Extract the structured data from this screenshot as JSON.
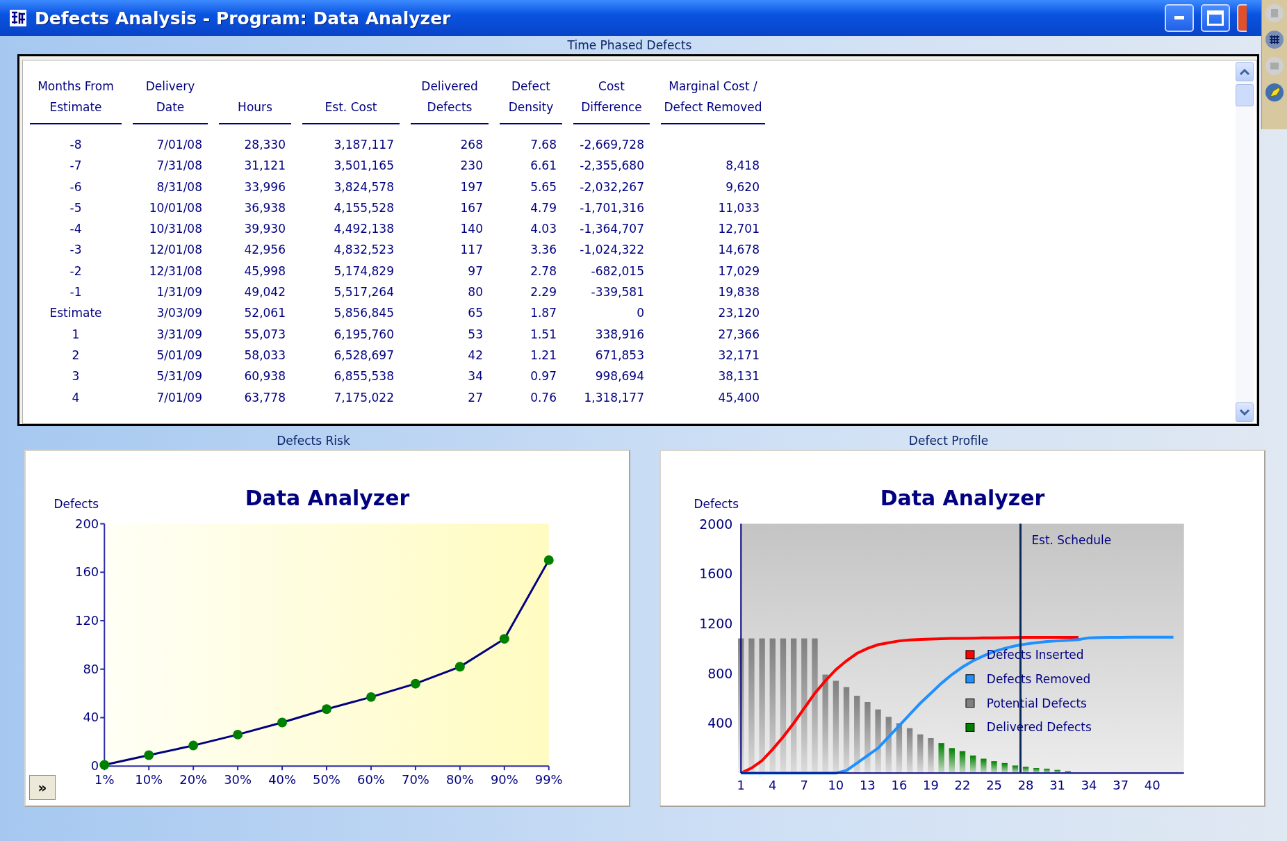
{
  "window": {
    "title": "Defects Analysis - Program: Data Analyzer"
  },
  "table": {
    "title": "Time Phased Defects",
    "columns": [
      "Months From\nEstimate",
      "Delivery\nDate",
      "Hours",
      "Est. Cost",
      "Delivered\nDefects",
      "Defect\nDensity",
      "Cost\nDifference",
      "Marginal Cost /\nDefect Removed"
    ],
    "rows": [
      [
        "-8",
        "7/01/08",
        "28,330",
        "3,187,117",
        "268",
        "7.68",
        "-2,669,728",
        ""
      ],
      [
        "-7",
        "7/31/08",
        "31,121",
        "3,501,165",
        "230",
        "6.61",
        "-2,355,680",
        "8,418"
      ],
      [
        "-6",
        "8/31/08",
        "33,996",
        "3,824,578",
        "197",
        "5.65",
        "-2,032,267",
        "9,620"
      ],
      [
        "-5",
        "10/01/08",
        "36,938",
        "4,155,528",
        "167",
        "4.79",
        "-1,701,316",
        "11,033"
      ],
      [
        "-4",
        "10/31/08",
        "39,930",
        "4,492,138",
        "140",
        "4.03",
        "-1,364,707",
        "12,701"
      ],
      [
        "-3",
        "12/01/08",
        "42,956",
        "4,832,523",
        "117",
        "3.36",
        "-1,024,322",
        "14,678"
      ],
      [
        "-2",
        "12/31/08",
        "45,998",
        "5,174,829",
        "97",
        "2.78",
        "-682,015",
        "17,029"
      ],
      [
        "-1",
        "1/31/09",
        "49,042",
        "5,517,264",
        "80",
        "2.29",
        "-339,581",
        "19,838"
      ],
      [
        "Estimate",
        "3/03/09",
        "52,061",
        "5,856,845",
        "65",
        "1.87",
        "0",
        "23,120"
      ],
      [
        "1",
        "3/31/09",
        "55,073",
        "6,195,760",
        "53",
        "1.51",
        "338,916",
        "27,366"
      ],
      [
        "2",
        "5/01/09",
        "58,033",
        "6,528,697",
        "42",
        "1.21",
        "671,853",
        "32,171"
      ],
      [
        "3",
        "5/31/09",
        "60,938",
        "6,855,538",
        "34",
        "0.97",
        "998,694",
        "38,131"
      ],
      [
        "4",
        "7/01/09",
        "63,778",
        "7,175,022",
        "27",
        "0.76",
        "1,318,177",
        "45,400"
      ]
    ]
  },
  "defects_risk": {
    "title": "Defects Risk",
    "expand_button": "»",
    "chart_data": {
      "type": "line",
      "title": "Data Analyzer",
      "ylabel": "Defects",
      "categories": [
        "1%",
        "10%",
        "20%",
        "30%",
        "40%",
        "50%",
        "60%",
        "70%",
        "80%",
        "90%",
        "99%"
      ],
      "series": [
        {
          "color": "#000080",
          "marker": true,
          "values": [
            1,
            9,
            17,
            26,
            36,
            47,
            57,
            68,
            82,
            105,
            170
          ]
        }
      ],
      "ylim": [
        0,
        200
      ],
      "yticks": [
        0,
        40,
        80,
        120,
        160,
        200
      ]
    }
  },
  "defect_profile": {
    "title": "Defect Profile",
    "chart_data": {
      "type": "bar",
      "title": "Data Analyzer",
      "ylabel": "Defects",
      "x": [
        1,
        2,
        3,
        4,
        5,
        6,
        7,
        8,
        9,
        10,
        11,
        12,
        13,
        14,
        15,
        16,
        17,
        18,
        19,
        20,
        21,
        22,
        23,
        24,
        25,
        26,
        27,
        28,
        29,
        30,
        31,
        32,
        33,
        34,
        35,
        36,
        37,
        38,
        39,
        40,
        41,
        42
      ],
      "series": [
        {
          "name": "Defects Inserted",
          "type": "line",
          "color": "#ff0000",
          "values": [
            0,
            40,
            100,
            190,
            290,
            400,
            520,
            640,
            740,
            830,
            900,
            960,
            1000,
            1030,
            1045,
            1060,
            1068,
            1072,
            1075,
            1078,
            1080,
            1080,
            1082,
            1084,
            1085,
            1086,
            1087,
            1088,
            1088,
            1088,
            1088,
            1089,
            1089,
            null,
            null,
            null,
            null,
            null,
            null,
            null,
            null,
            null
          ]
        },
        {
          "name": "Defects Removed",
          "type": "line",
          "color": "#1e90ff",
          "values": [
            0,
            0,
            0,
            0,
            0,
            0,
            0,
            0,
            0,
            0,
            20,
            80,
            140,
            200,
            290,
            380,
            470,
            560,
            640,
            720,
            790,
            850,
            900,
            940,
            975,
            1000,
            1020,
            1035,
            1045,
            1055,
            1060,
            1065,
            1070,
            1085,
            1087,
            1088,
            1089,
            1090,
            1090,
            1090,
            1090,
            1090
          ]
        },
        {
          "name": "Potential Defects",
          "type": "bar",
          "color": "#808080",
          "values": [
            1080,
            1080,
            1080,
            1080,
            1080,
            1080,
            1080,
            1080,
            790,
            740,
            690,
            620,
            570,
            510,
            450,
            400,
            360,
            310,
            280,
            null,
            null,
            null,
            null,
            null,
            null,
            null,
            null,
            null,
            null,
            null,
            null,
            null,
            null,
            null,
            null,
            null,
            null,
            null,
            null,
            null,
            null,
            null
          ]
        },
        {
          "name": "Delivered Defects",
          "type": "bar",
          "color": "#008000",
          "values": [
            null,
            null,
            null,
            null,
            null,
            null,
            null,
            null,
            null,
            null,
            null,
            null,
            null,
            null,
            null,
            null,
            null,
            null,
            null,
            240,
            200,
            175,
            140,
            115,
            95,
            80,
            60,
            50,
            40,
            35,
            25,
            15,
            null,
            null,
            null,
            null,
            null,
            null,
            null,
            null,
            null,
            null
          ]
        }
      ],
      "xlim": [
        1,
        43
      ],
      "ylim": [
        0,
        2000
      ],
      "xticks": [
        1,
        4,
        7,
        10,
        13,
        16,
        19,
        22,
        25,
        28,
        31,
        34,
        37,
        40
      ],
      "yticks": [
        400,
        800,
        1200,
        1600,
        2000
      ],
      "legend": true,
      "ref_lines": [
        {
          "axis": "x",
          "value": 27.5,
          "label": "Est. Schedule"
        }
      ]
    }
  }
}
